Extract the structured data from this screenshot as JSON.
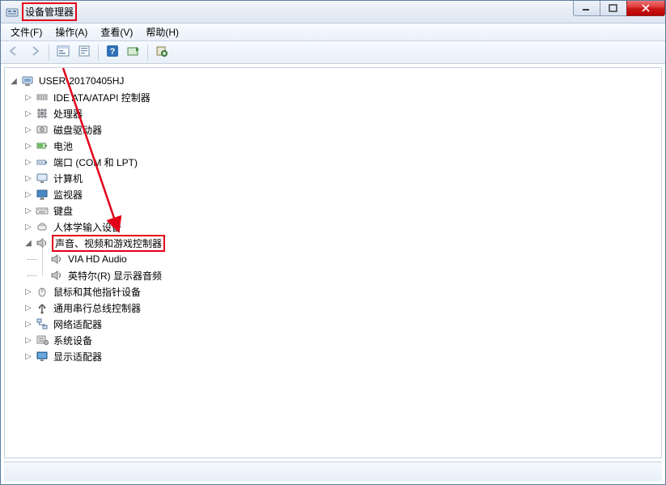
{
  "window": {
    "title": "设备管理器"
  },
  "menu": {
    "file": "文件(F)",
    "action": "操作(A)",
    "view": "查看(V)",
    "help": "帮助(H)"
  },
  "toolbar": {
    "back": "back-arrow",
    "forward": "forward-arrow",
    "up": "show-hidden",
    "properties": "properties",
    "help": "help",
    "scan": "scan-hardware",
    "uninstall": "uninstall"
  },
  "root": {
    "label": "USER-20170405HJ"
  },
  "categories": [
    {
      "id": "ide",
      "label": "IDE ATA/ATAPI 控制器",
      "icon": "controller-icon"
    },
    {
      "id": "cpu",
      "label": "处理器",
      "icon": "cpu-icon"
    },
    {
      "id": "disk",
      "label": "磁盘驱动器",
      "icon": "disk-icon"
    },
    {
      "id": "battery",
      "label": "电池",
      "icon": "battery-icon"
    },
    {
      "id": "ports",
      "label": "端口 (COM 和 LPT)",
      "icon": "port-icon"
    },
    {
      "id": "computer",
      "label": "计算机",
      "icon": "computer-icon"
    },
    {
      "id": "monitor",
      "label": "监视器",
      "icon": "monitor-icon"
    },
    {
      "id": "keyboard",
      "label": "键盘",
      "icon": "keyboard-icon"
    },
    {
      "id": "hid",
      "label": "人体学输入设备",
      "icon": "hid-icon"
    },
    {
      "id": "sound",
      "label": "声音、视频和游戏控制器",
      "icon": "sound-icon",
      "expanded": true,
      "highlight": true,
      "children": [
        {
          "label": "VIA HD Audio",
          "icon": "speaker-icon"
        },
        {
          "label": "英特尔(R) 显示器音频",
          "icon": "speaker-icon"
        }
      ]
    },
    {
      "id": "mouse",
      "label": "鼠标和其他指针设备",
      "icon": "mouse-icon"
    },
    {
      "id": "usb",
      "label": "通用串行总线控制器",
      "icon": "usb-icon"
    },
    {
      "id": "network",
      "label": "网络适配器",
      "icon": "network-icon"
    },
    {
      "id": "system",
      "label": "系统设备",
      "icon": "system-icon"
    },
    {
      "id": "display",
      "label": "显示适配器",
      "icon": "display-icon"
    }
  ]
}
